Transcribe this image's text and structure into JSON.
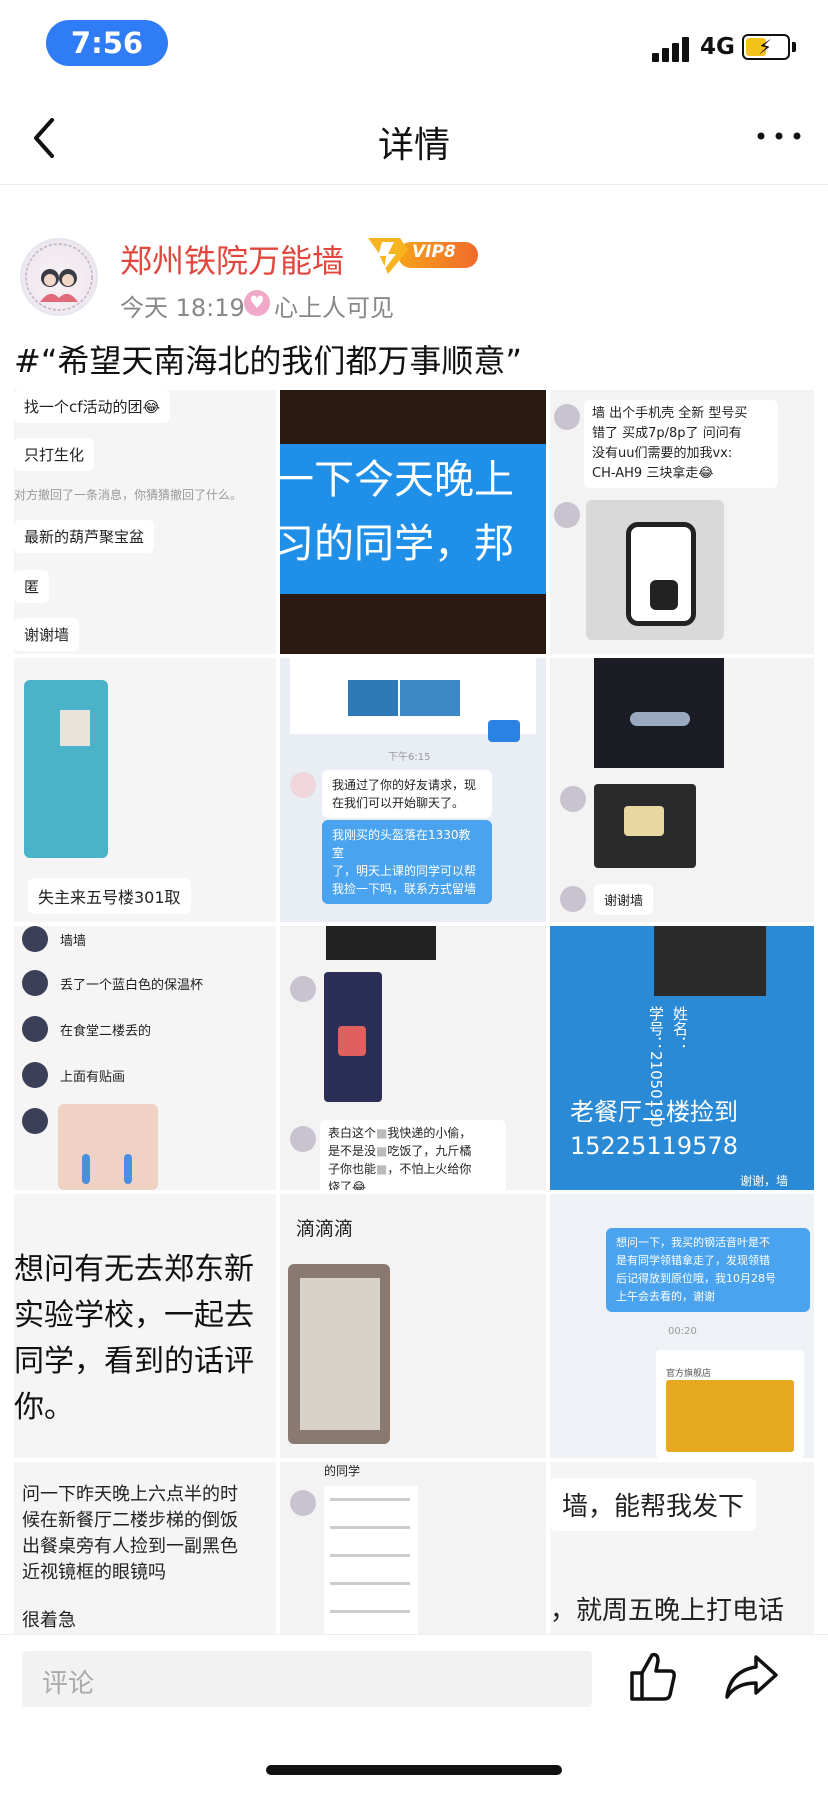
{
  "status": {
    "time": "7:56",
    "network": "4G"
  },
  "nav": {
    "title": "详情"
  },
  "post": {
    "username": "郑州铁院万能墙",
    "vip_label": "VIP8",
    "time": "今天 18:19",
    "visibility": "心上人可见",
    "text": "#“希望天南海北的我们都万事顺意”"
  },
  "grid": {
    "c1": {
      "lines": [
        "找一个cf活动的团😂",
        "只打生化",
        "对方撤回了一条消息，你猜猜撤回了什么。",
        "最新的葫芦聚宝盆",
        "匿",
        "谢谢墙"
      ]
    },
    "c2": {
      "line1": "一下今天晚上",
      "line2": "习的同学，邦"
    },
    "c3": {
      "text1": "墙 出个手机壳 全新 型号买",
      "text2": "错了 买成7p/8p了 问问有",
      "text3": "没有uu们需要的加我vx:",
      "text4": "CH-AH9 三块拿走😂"
    },
    "c4": {
      "caption": "失主来五号楼301取"
    },
    "c5": {
      "time": "下午6:15",
      "bubble1a": "我通过了你的好友请求，现",
      "bubble1b": "在我们可以开始聊天了。",
      "bubble2a": "我刚买的头盔落在1330教室",
      "bubble2b": "了，明天上课的同学可以帮",
      "bubble2c": "我捡一下吗，联系方式留墙"
    },
    "c6": {
      "caption": "谢谢墙"
    },
    "c7": {
      "l1": "墙墙",
      "l2": "丢了一个蓝白色的保温杯",
      "l3": "在食堂二楼丢的",
      "l4": "上面有贴画"
    },
    "c8": {
      "a": "表白这个",
      "a2": "我快递的小偷，",
      "b": "是不是没",
      "b2": "吃饭了，九斤橘",
      "c": "子你也能",
      "c2": "，不怕上火给你",
      "d": "烧了😂"
    },
    "c9": {
      "name": "姓名：",
      "id": "学号：21050190",
      "line1": "老餐厅二楼捡到",
      "line2": "15225119578",
      "corner": "谢谢，墙"
    },
    "c10": {
      "l1": "想问有无去郑东新",
      "l2": "实验学校，一起去",
      "l3": "同学，看到的话评",
      "l4": "你。"
    },
    "c11": {
      "title": "滴滴滴"
    },
    "c12": {
      "a": "想问一下，我买的钢活音叶是不",
      "b": "是有同学领错拿走了，发现领错",
      "c": "后记得放到原位哦，我10月28号",
      "d": "上午会去看的，谢谢",
      "time": "00:20",
      "brand": "官方旗舰店"
    },
    "c13": {
      "l1": "问一下昨天晚上六点半的时",
      "l2": "候在新餐厅二楼步梯的倒饭",
      "l3": "出餐桌旁有人捡到一副黑色",
      "l4": "近视镜框的眼镜吗",
      "l5": "很着急"
    },
    "c14": {
      "top": "的同学"
    },
    "c15": {
      "l1": "墙，能帮我发下",
      "l2": "，就周五晚上打电话"
    }
  },
  "bottom": {
    "placeholder": "评论"
  },
  "colors": {
    "accent": "#2f7cf6",
    "username": "#e2473f",
    "chat_blue": "#4aa3ee"
  }
}
